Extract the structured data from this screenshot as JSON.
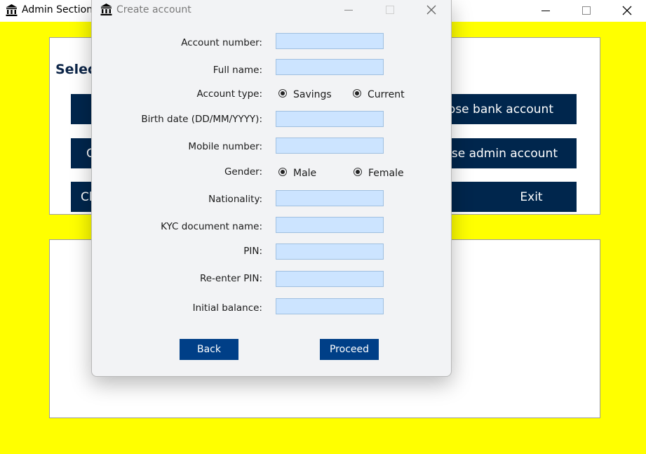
{
  "main_window": {
    "title": "Admin Section",
    "panel_title": "Selec",
    "buttons": {
      "b1": "",
      "b2": "C",
      "b3": "Cl",
      "close_bank": "ose bank account",
      "close_admin": "ose admin account",
      "exit": "Exit"
    },
    "colors": {
      "background": "#ffff00",
      "button": "#00264d"
    }
  },
  "dialog": {
    "title": "Create account",
    "fields": {
      "account_number": "Account number:",
      "full_name": "Full name:",
      "account_type": "Account type:",
      "birth_date": "Birth date (DD/MM/YYYY):",
      "mobile_number": "Mobile number:",
      "gender": "Gender:",
      "nationality": "Nationality:",
      "kyc": "KYC document name:",
      "pin": "PIN:",
      "reenter_pin": "Re-enter PIN:",
      "initial_balance": "Initial balance:"
    },
    "values": {
      "account_number": "",
      "full_name": "",
      "birth_date": "",
      "mobile_number": "",
      "nationality": "",
      "kyc": "",
      "pin": "",
      "reenter_pin": "",
      "initial_balance": ""
    },
    "account_type_options": [
      "Savings",
      "Current"
    ],
    "gender_options": [
      "Male",
      "Female"
    ],
    "buttons": {
      "back": "Back",
      "proceed": "Proceed"
    },
    "colors": {
      "input": "#cce4ff",
      "button": "#003f87"
    }
  },
  "icons": [
    "bank-icon",
    "minimize-icon",
    "maximize-icon",
    "close-icon"
  ]
}
